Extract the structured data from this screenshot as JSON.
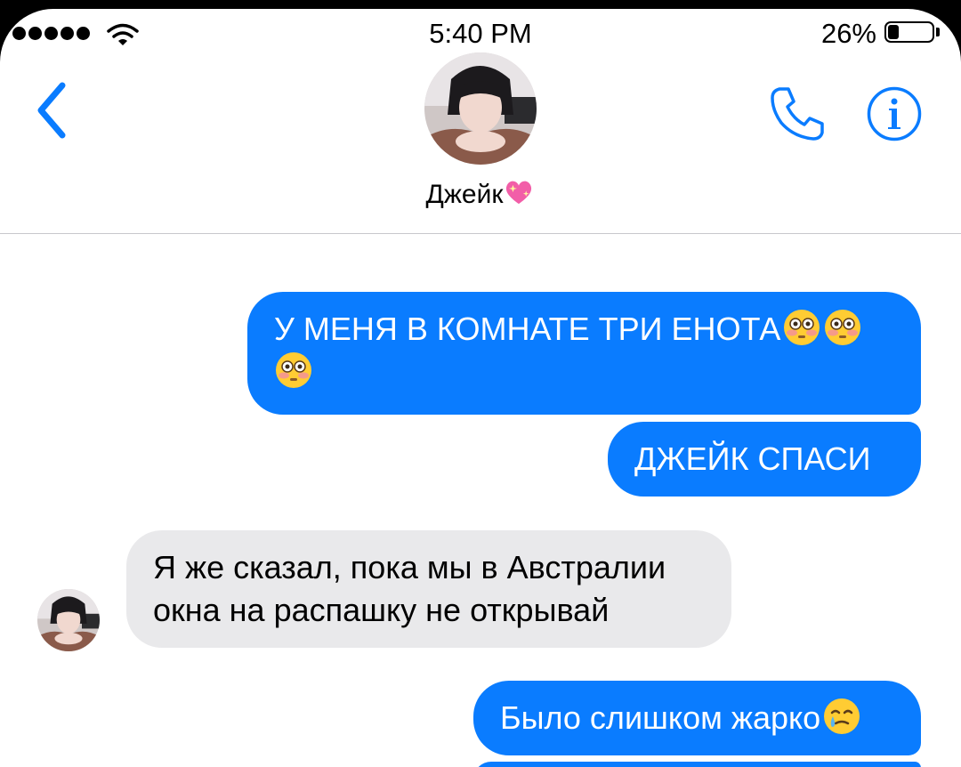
{
  "status_bar": {
    "time": "5:40 PM",
    "battery_percent": "26%",
    "battery_level": 0.26,
    "signal_bars": 5,
    "icons": [
      "signal-dots-icon",
      "wifi-icon",
      "battery-icon"
    ]
  },
  "header": {
    "contact_name": "Джейк",
    "name_emoji": "sparkling-heart-icon",
    "icons": [
      "back-chevron-icon",
      "phone-icon",
      "info-icon"
    ]
  },
  "messages": [
    {
      "direction": "outgoing",
      "text": "У МЕНЯ В КОМНАТЕ ТРИ ЕНОТА",
      "emojis": [
        "flushed-face-icon",
        "flushed-face-icon",
        "flushed-face-icon"
      ]
    },
    {
      "direction": "outgoing",
      "text": "ДЖЕЙК СПАСИ"
    },
    {
      "direction": "incoming",
      "text": "Я же сказал, пока мы в Австралии окна на распашку не открывай"
    },
    {
      "direction": "outgoing",
      "text": "Было слишком жарко",
      "emojis": [
        "crying-smile-face-icon"
      ]
    }
  ],
  "colors": {
    "accent": "#0a7cff",
    "outgoing_bubble": "#0a7cff",
    "incoming_bubble": "#e9e9eb",
    "divider": "#c8c8cc"
  }
}
